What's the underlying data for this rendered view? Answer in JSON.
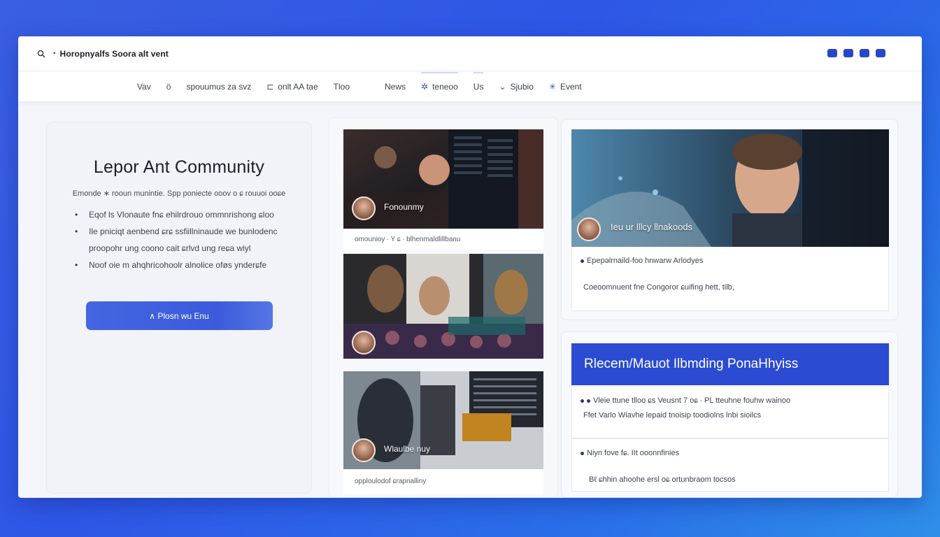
{
  "window": {
    "title": "Horopnyalfs Soora alt vent",
    "title_icon": "search-icon"
  },
  "nav": {
    "items": [
      {
        "label": "Vav",
        "icon": ""
      },
      {
        "label": "",
        "icon": "profile-icon"
      },
      {
        "label": "spouumus za svz",
        "icon": ""
      },
      {
        "label": "onlt AA tae",
        "icon": "bracket-icon"
      },
      {
        "label": "Tloo",
        "icon": ""
      },
      {
        "label": "News",
        "icon": ""
      },
      {
        "label": "teneoo",
        "icon": "star-icon"
      },
      {
        "label": "Us",
        "icon": ""
      },
      {
        "label": "Sjubio",
        "icon": "chevron-icon"
      },
      {
        "label": "Event",
        "icon": "sparkle-icon"
      }
    ]
  },
  "community": {
    "heading": "Lepor Ant Community",
    "intro": "Emonde ∗ rooun munintie. Spp poniecte ooov o ɕ rouuoi ooɕe",
    "bullets": [
      {
        "text": "Eqof ls Vlonaute fnɕ ehilrdrouo ommnrishong ɕloo",
        "bullet": true
      },
      {
        "text": "Ile pniciqt aenbend ɕrɕ ssfiillninaude we bunlodenc",
        "bullet": true
      },
      {
        "text": "proopohr ung coono cait ɕrlvd ung reɕa wiyl",
        "bullet": false
      },
      {
        "text": "Noof oie m ahqhricohoolr alnolice oføs ynderɕfe",
        "bullet": true
      }
    ],
    "cta_label": "∧ Plosn wu Enu"
  },
  "feed": {
    "cards": [
      {
        "name": "Fonounmy",
        "caption": "omounioy ∙ Y ɕ ∙ blhenmaldlillbanu"
      },
      {
        "name": "",
        "caption": ""
      },
      {
        "name": "Wlaulbe nuy",
        "caption": "opploulodof ɕrapnalliny"
      }
    ]
  },
  "featured": {
    "overlay_name": "Ieu ur lllcy llnakoods",
    "line1": "Epepəlrnaild-foo hnwarw Arlodyes",
    "line2": "Coeoomnuent fne Congoror ɕuifing hett, tilb,"
  },
  "recent": {
    "banner": "Rlecem/Mauot Ilbmding PonaHhyiss",
    "item1_line1": "Vleie ttune tlloo ɕs Veusnt 7 oɕ ∙ PL tteuhne fouhw wainoo",
    "item1_line2": "Ffet Varlo Wiavhe lepaid tnoisip toodiolns lnbi sioilcs",
    "item2": "Niyn fove fɕ. IIt ooonnfinies",
    "item3": "Bℓ ɕhhin ahoohe ersl oɕ ortunbraom tocsos"
  },
  "colors": {
    "accent": "#2a4bd2",
    "button": "#4466e2",
    "background": "#2f56e6"
  }
}
